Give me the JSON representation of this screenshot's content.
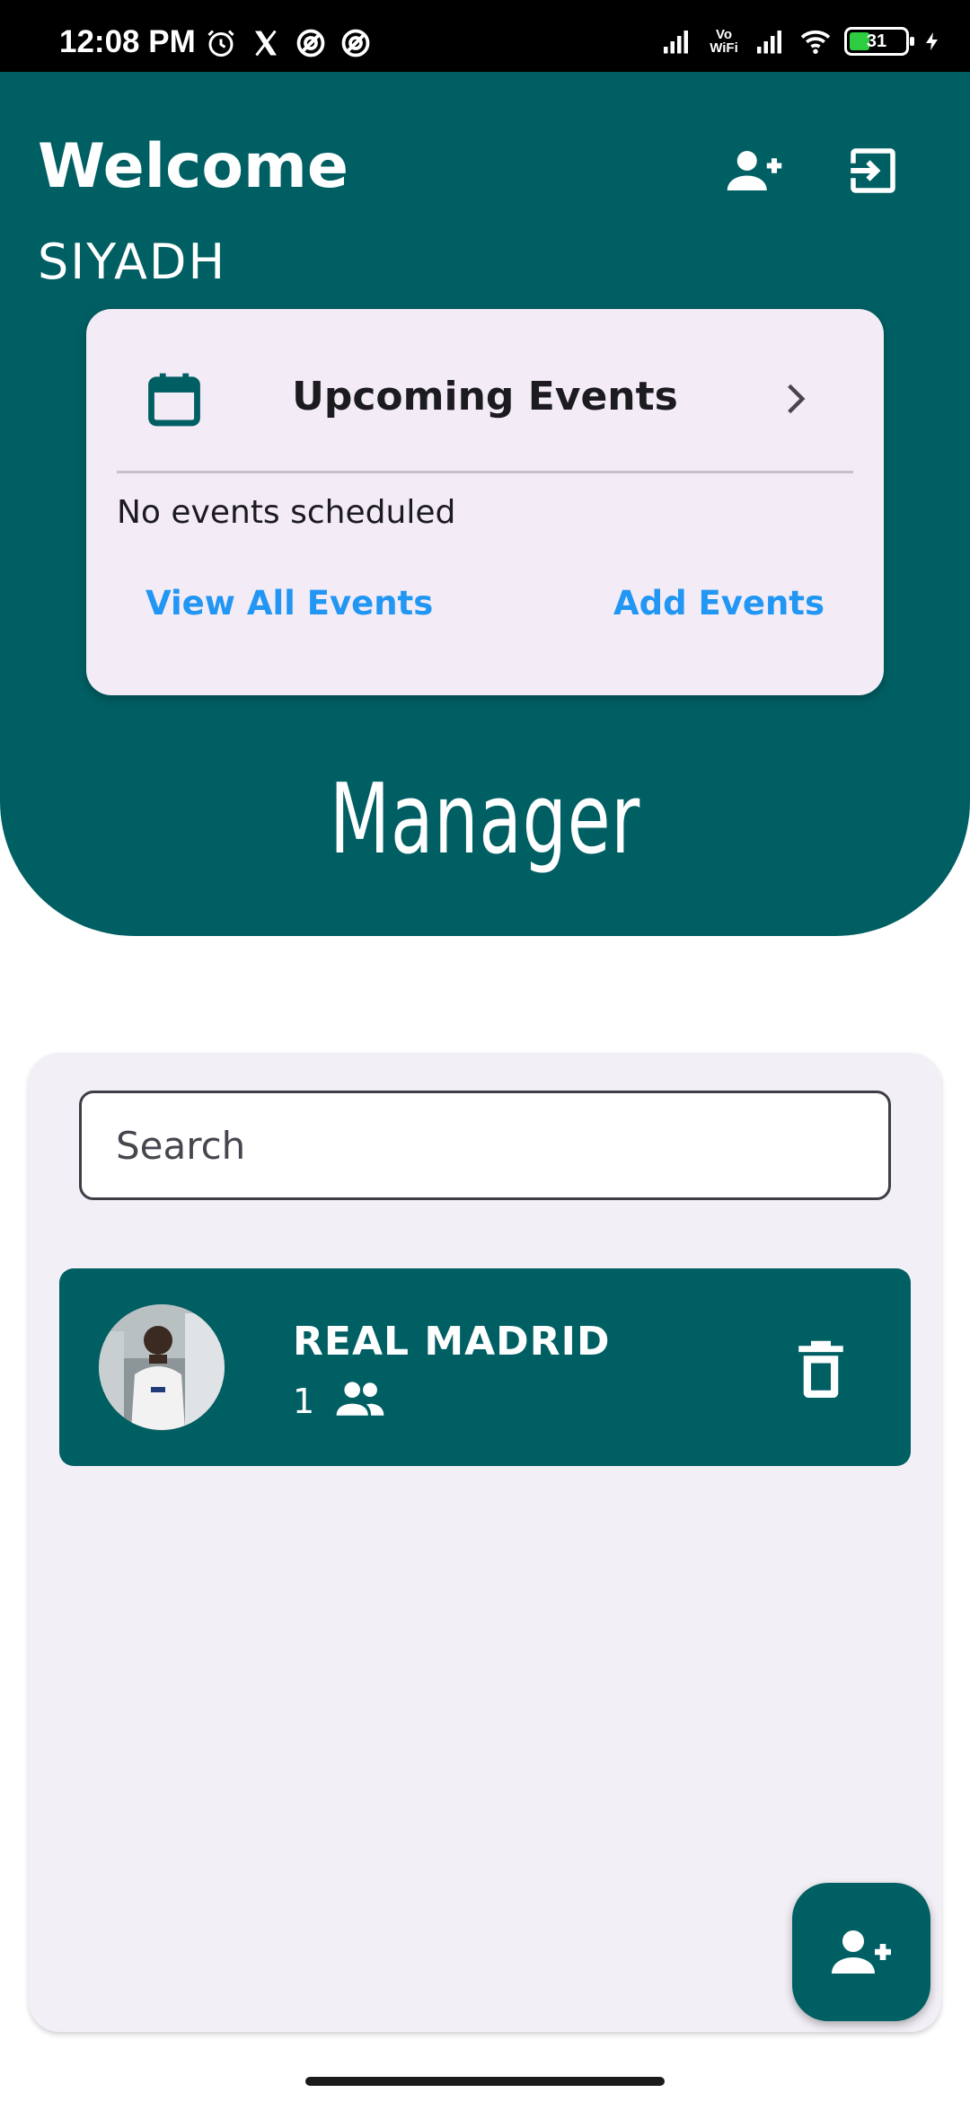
{
  "status_bar": {
    "time": "12:08 PM",
    "vowifi_top": "Vo",
    "vowifi_bottom": "WiFi",
    "battery_level": "31"
  },
  "header": {
    "welcome": "Welcome",
    "username": "SIYADH",
    "add_user_icon": "person-add-icon",
    "logout_icon": "logout-icon",
    "role_title": "Manager",
    "background_color": "#005f63"
  },
  "events_card": {
    "title": "Upcoming Events",
    "empty_message": "No events scheduled",
    "view_all_label": "View All Events",
    "add_label": "Add Events",
    "link_color": "#2196f3"
  },
  "main": {
    "search_placeholder": "Search",
    "teams": [
      {
        "name": "REAL MADRID",
        "member_count": "1"
      }
    ]
  },
  "fab": {
    "icon": "person-add-icon"
  }
}
